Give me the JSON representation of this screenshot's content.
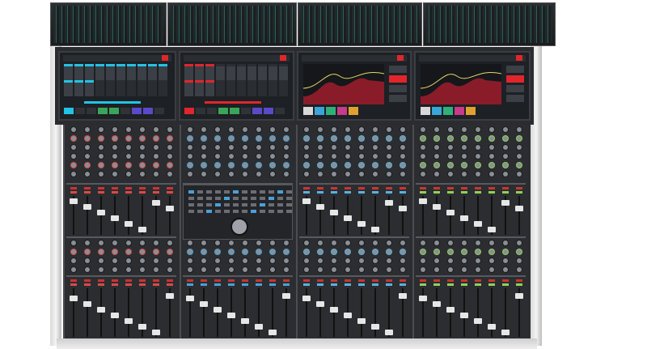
{
  "console": {
    "colors": {
      "frame": "#d9d9d9",
      "surface": "#2b2d30",
      "screen_bg": "#1d2024",
      "accent_cyan": "#22c3e6",
      "accent_red": "#e0262c",
      "eq_curve_fill": "#8a1c2a",
      "meter_green": "#2f6b5e",
      "fader_cap": "#e6e6e6"
    },
    "screens": [
      {
        "type": "channel-grid",
        "accent": "#22c3e6"
      },
      {
        "type": "channel-grid",
        "accent": "#e0262c"
      },
      {
        "type": "eq-graph",
        "accent": "#e0262c"
      },
      {
        "type": "eq-graph",
        "accent": "#e0262c"
      }
    ],
    "bays": [
      {
        "accent": "#d84a4a"
      },
      {
        "accent": "#4aa0d8",
        "has_master_section": true
      },
      {
        "accent": "#5ab0e0"
      },
      {
        "accent": "#8fd05a"
      }
    ]
  }
}
